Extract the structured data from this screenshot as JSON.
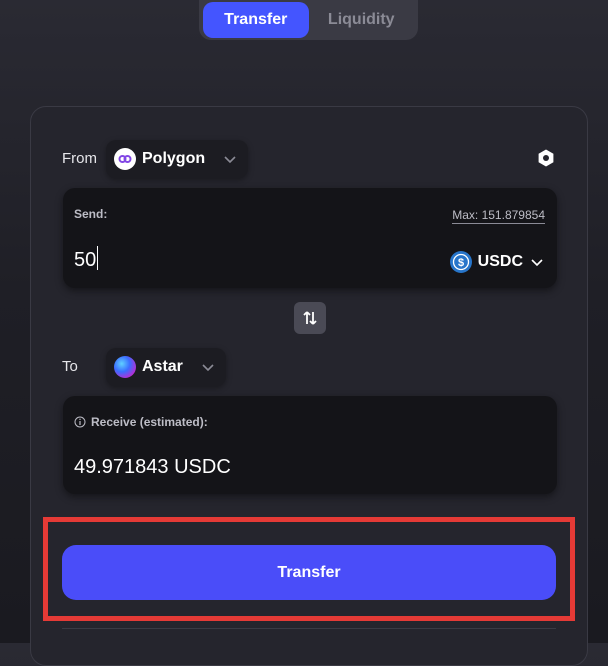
{
  "tabs": [
    {
      "label": "Transfer",
      "active": true
    },
    {
      "label": "Liquidity",
      "active": false
    }
  ],
  "from": {
    "label": "From",
    "chain": "Polygon",
    "chain_icon": "polygon-icon"
  },
  "send": {
    "label": "Send:",
    "max_label": "Max: 151.879854",
    "amount": "50",
    "token": "USDC",
    "token_icon": "usdc-icon"
  },
  "to": {
    "label": "To",
    "chain": "Astar",
    "chain_icon": "astar-icon"
  },
  "receive": {
    "label": "Receive (estimated):",
    "value": "49.971843 USDC"
  },
  "actions": {
    "transfer_label": "Transfer"
  },
  "colors": {
    "accent": "#4a4df9",
    "highlight": "#e53a36",
    "background": "#1f1f26"
  }
}
